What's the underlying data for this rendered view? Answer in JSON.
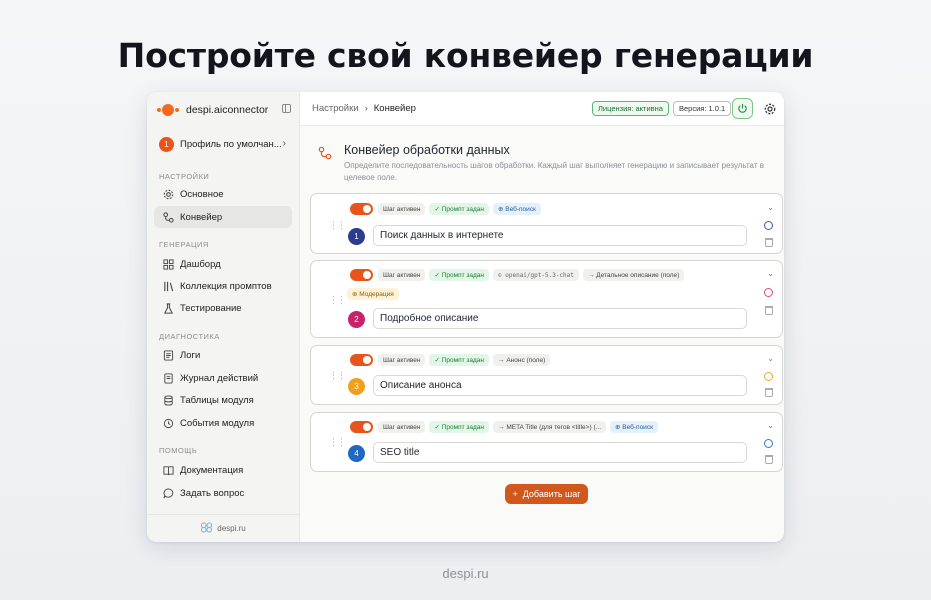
{
  "hero": {
    "title": "Постройте свой конвейер генерации"
  },
  "footer": {
    "site": "despi.ru"
  },
  "sidebar": {
    "brand": "despi.aiconnector",
    "profile": {
      "number": "1",
      "label": "Профиль по умолчан..."
    },
    "sections": [
      {
        "title": "НАСТРОЙКИ",
        "items": [
          {
            "label": "Основное",
            "icon": "gear-icon"
          },
          {
            "label": "Конвейер",
            "icon": "pipeline-icon",
            "active": true
          }
        ]
      },
      {
        "title": "ГЕНЕРАЦИЯ",
        "items": [
          {
            "label": "Дашборд",
            "icon": "dashboard-icon"
          },
          {
            "label": "Коллекция промптов",
            "icon": "library-icon"
          },
          {
            "label": "Тестирование",
            "icon": "flask-icon"
          }
        ]
      },
      {
        "title": "ДИАГНОСТИКА",
        "items": [
          {
            "label": "Логи",
            "icon": "log-icon"
          },
          {
            "label": "Журнал действий",
            "icon": "journal-icon"
          },
          {
            "label": "Таблицы модуля",
            "icon": "database-icon"
          },
          {
            "label": "События модуля",
            "icon": "events-icon"
          }
        ]
      },
      {
        "title": "ПОМОЩЬ",
        "items": [
          {
            "label": "Документация",
            "icon": "book-icon"
          },
          {
            "label": "Задать вопрос",
            "icon": "chat-icon"
          }
        ]
      }
    ],
    "footer": "despi.ru"
  },
  "topbar": {
    "breadcrumb": [
      "Настройки",
      "Конвейер"
    ],
    "license": "Лицензия: активна",
    "version": "Версия: 1.0.1"
  },
  "page": {
    "title": "Конвейер обработки данных",
    "description": "Определите последовательность шагов обработки. Каждый шаг выполняет генерацию и записывает результат в целевое поле."
  },
  "steps": [
    {
      "number": "1",
      "color": "#2c3d8f",
      "palette_color": "#3a58c4",
      "name": "Поиск данных в интернете",
      "chips": [
        {
          "type": "gray",
          "text": "Шаг активен"
        },
        {
          "type": "green",
          "text": "✓ Промпт задан"
        },
        {
          "type": "blue",
          "text": "⊕ Веб-поиск"
        }
      ]
    },
    {
      "number": "2",
      "color": "#c7236a",
      "palette_color": "#d94c7b",
      "name": "Подробное описание",
      "chips": [
        {
          "type": "gray",
          "text": "Шаг активен"
        },
        {
          "type": "green",
          "text": "✓ Промпт задан"
        },
        {
          "type": "mono",
          "text": "⊙ openai/gpt-5.3-chat"
        },
        {
          "type": "gray",
          "text": "→ Детальное описание (поле)"
        }
      ],
      "chips2": [
        {
          "type": "yellow",
          "text": "⊛ Модерация"
        }
      ]
    },
    {
      "number": "3",
      "color": "#f0a020",
      "palette_color": "#e8a928",
      "name": "Описание анонса",
      "chips": [
        {
          "type": "gray",
          "text": "Шаг активен"
        },
        {
          "type": "green",
          "text": "✓ Промпт задан"
        },
        {
          "type": "gray",
          "text": "→ Анонс (поле)"
        }
      ]
    },
    {
      "number": "4",
      "color": "#1e68c0",
      "palette_color": "#2f7ad0",
      "name": "SEO title",
      "chips": [
        {
          "type": "gray",
          "text": "Шаг активен"
        },
        {
          "type": "green",
          "text": "✓ Промпт задан"
        },
        {
          "type": "gray",
          "text": "→ META Title (для тегов <title>) (..."
        },
        {
          "type": "blue",
          "text": "⊕ Веб-поиск"
        }
      ]
    }
  ],
  "add_step": "Добавить шаг"
}
